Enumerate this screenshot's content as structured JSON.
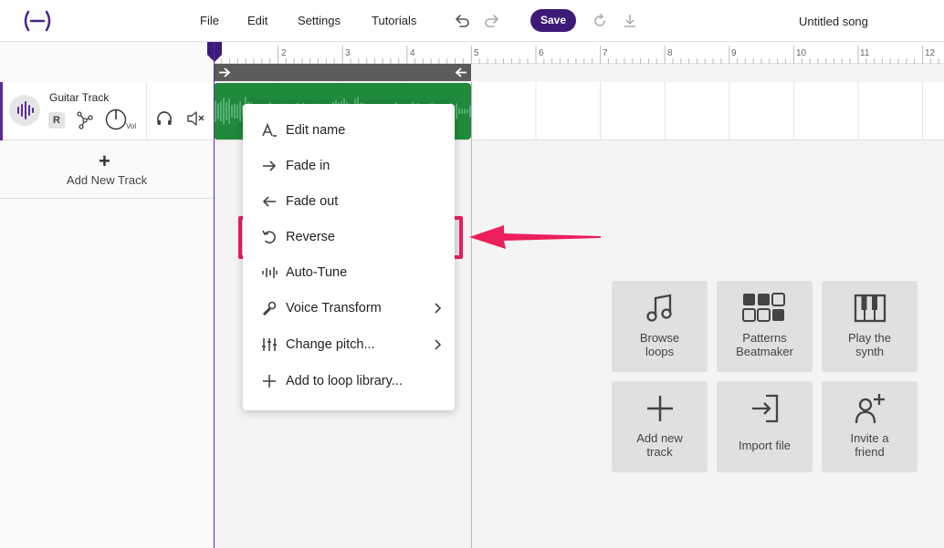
{
  "header": {
    "menu": [
      "File",
      "Edit",
      "Settings",
      "Tutorials"
    ],
    "save_label": "Save",
    "song_title": "Untitled song"
  },
  "track": {
    "name": "Guitar Track",
    "record_label": "R",
    "volume_label": "Vol"
  },
  "add_track": {
    "plus": "+",
    "label": "Add New Track"
  },
  "ruler": {
    "numbers": [
      "2",
      "3",
      "4",
      "5",
      "6",
      "7",
      "8",
      "9",
      "10",
      "11",
      "12"
    ]
  },
  "context_menu": {
    "items": [
      {
        "label": "Edit name",
        "icon": "text-cursor-icon"
      },
      {
        "label": "Fade in",
        "icon": "arrow-right-icon"
      },
      {
        "label": "Fade out",
        "icon": "arrow-left-icon"
      },
      {
        "label": "Reverse",
        "icon": "reverse-icon"
      },
      {
        "label": "Auto-Tune",
        "icon": "waveform-icon"
      },
      {
        "label": "Voice Transform",
        "icon": "microphone-icon"
      },
      {
        "label": "Change pitch...",
        "icon": "sliders-icon"
      },
      {
        "label": "Add to loop library...",
        "icon": "plus-icon"
      }
    ]
  },
  "tiles": [
    {
      "label_line1": "Browse",
      "label_line2": "loops",
      "icon": "music-note-icon"
    },
    {
      "label_line1": "Patterns",
      "label_line2": "Beatmaker",
      "icon": "grid-pads-icon"
    },
    {
      "label_line1": "Play the",
      "label_line2": "synth",
      "icon": "piano-keys-icon"
    },
    {
      "label_line1": "Add new",
      "label_line2": "track",
      "icon": "plus-icon"
    },
    {
      "label_line1": "Import file",
      "label_line2": "",
      "icon": "import-icon"
    },
    {
      "label_line1": "Invite a",
      "label_line2": "friend",
      "icon": "add-user-icon"
    }
  ],
  "colors": {
    "brand": "#3d1a78",
    "clip": "#1f8a3c",
    "highlight": "#ec1e5c"
  }
}
